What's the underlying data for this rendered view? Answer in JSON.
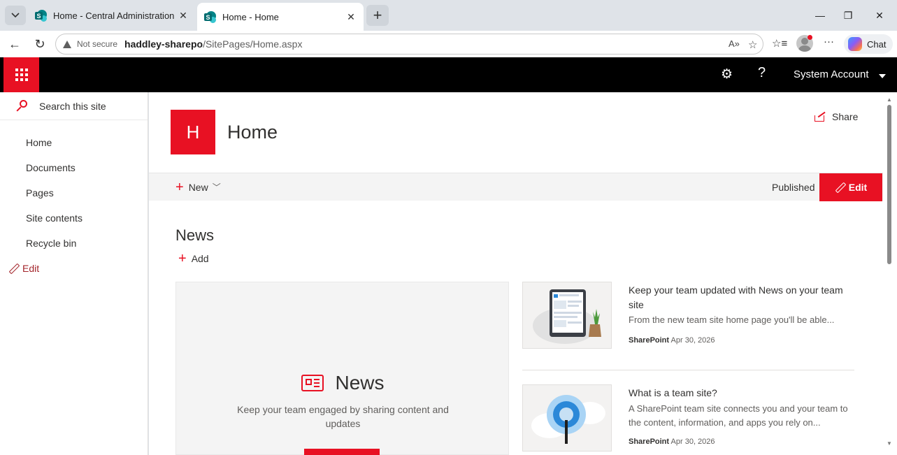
{
  "browser": {
    "tabs": [
      {
        "title": "Home - Central Administration",
        "active": false
      },
      {
        "title": "Home - Home",
        "active": true
      }
    ],
    "address": {
      "security": "Not secure",
      "host": "haddley-sharepo",
      "path": "/SitePages/Home.aspx"
    },
    "chat_label": "Chat"
  },
  "suitebar": {
    "account_name": "System Account",
    "accent_color": "#e81123"
  },
  "leftnav": {
    "search_placeholder": "Search this site",
    "items": [
      {
        "label": "Home"
      },
      {
        "label": "Documents"
      },
      {
        "label": "Pages"
      },
      {
        "label": "Site contents"
      },
      {
        "label": "Recycle bin"
      }
    ],
    "edit_label": "Edit"
  },
  "site": {
    "logo_letter": "H",
    "title": "Home",
    "share_label": "Share"
  },
  "commandbar": {
    "new_label": "New",
    "status": "Published",
    "edit_label": "Edit"
  },
  "news": {
    "heading": "News",
    "add_label": "Add",
    "hero": {
      "title": "News",
      "text": "Keep your team engaged by sharing content and updates"
    },
    "items": [
      {
        "title": "Keep your team updated with News on your team site",
        "description": "From the new team site home page you'll be able...",
        "author": "SharePoint",
        "date": "Apr 30, 2026"
      },
      {
        "title": "What is a team site?",
        "description": "A SharePoint team site connects you and your team to the content, information, and apps you rely on...",
        "author": "SharePoint",
        "date": "Apr 30, 2026"
      }
    ]
  }
}
